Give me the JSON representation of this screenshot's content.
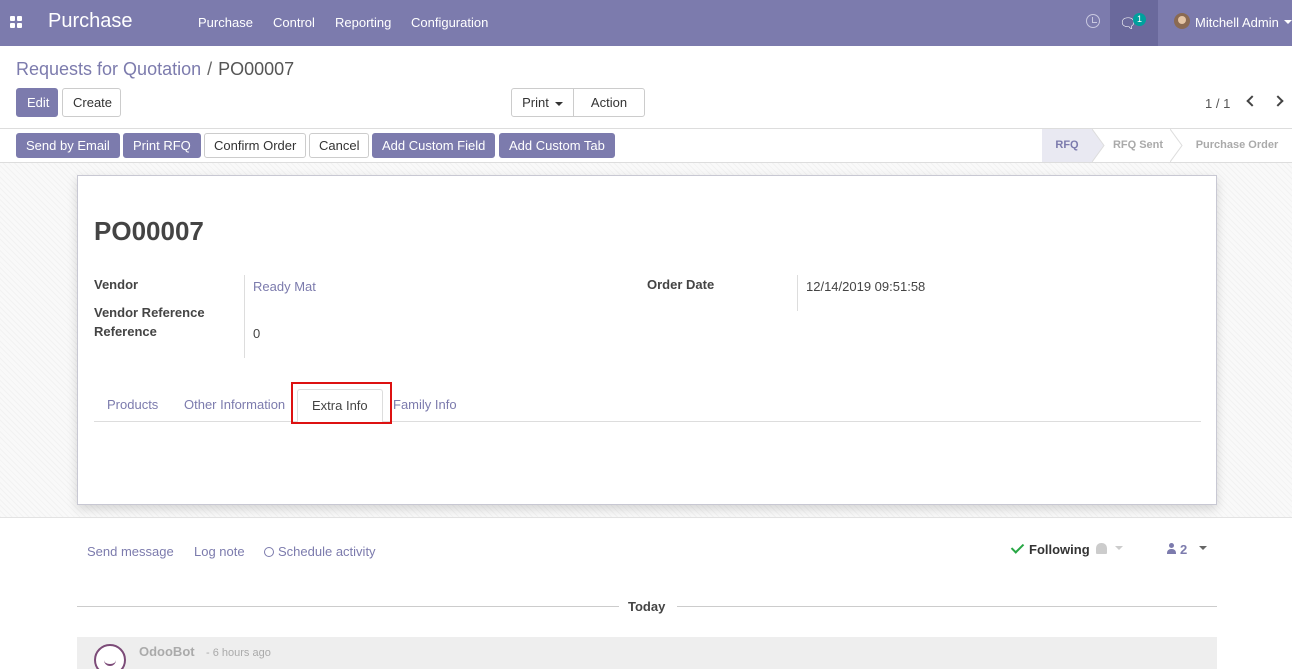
{
  "topnav": {
    "brand": "Purchase",
    "menu": [
      "Purchase",
      "Control",
      "Reporting",
      "Configuration"
    ],
    "message_count": "1",
    "user_name": "Mitchell Admin",
    "bar_color": "#7c7bad"
  },
  "breadcrumb": {
    "parent": "Requests for Quotation",
    "separator": "/",
    "current": "PO00007"
  },
  "buttons": {
    "edit": "Edit",
    "create": "Create",
    "print": "Print",
    "action": "Action"
  },
  "pager": {
    "value": "1 / 1"
  },
  "statusbar": {
    "buttons": [
      "Send by Email",
      "Print RFQ",
      "Confirm Order",
      "Cancel",
      "Add Custom Field",
      "Add Custom Tab"
    ],
    "stages": [
      "RFQ",
      "RFQ Sent",
      "Purchase Order"
    ],
    "active_stage": "RFQ"
  },
  "form": {
    "title": "PO00007",
    "vendor_label": "Vendor",
    "vendor_value": "Ready Mat",
    "vendor_reference_label": "Vendor Reference",
    "reference_label": "Reference",
    "reference_value": "0",
    "order_date_label": "Order Date",
    "order_date_value": "12/14/2019 09:51:58"
  },
  "tabs": [
    "Products",
    "Other Information",
    "Extra Info",
    "Family Info"
  ],
  "active_tab": "Extra Info",
  "chatter": {
    "send_message": "Send message",
    "log_note": "Log note",
    "schedule_activity": "Schedule activity",
    "following": "Following",
    "followers_count": "2",
    "separator_label": "Today",
    "message": {
      "author": "OdooBot",
      "time": "- 6 hours ago"
    }
  }
}
